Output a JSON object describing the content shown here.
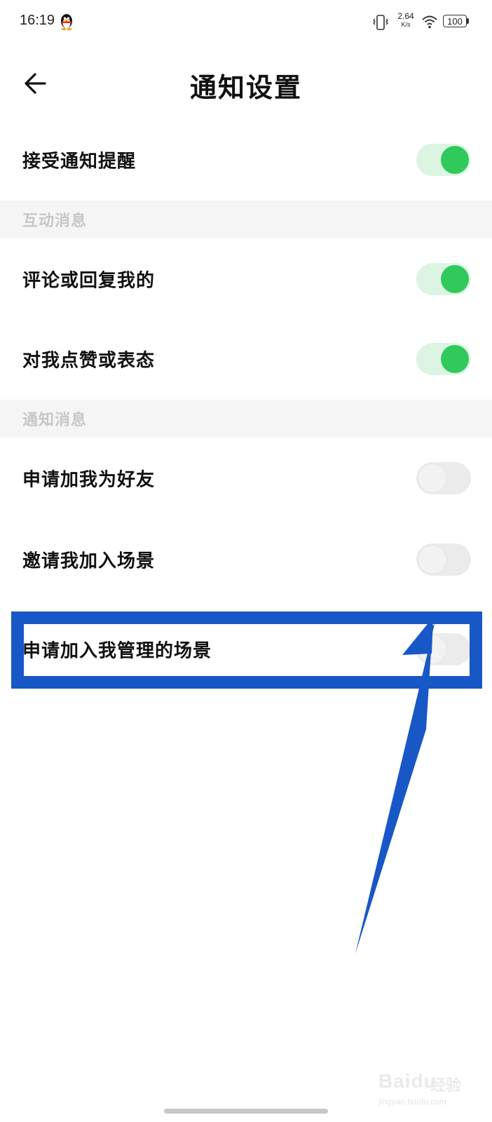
{
  "status_bar": {
    "time": "16:19",
    "net_speed_value": "2.64",
    "net_speed_unit": "K/s",
    "battery": "100"
  },
  "header": {
    "title": "通知设置"
  },
  "main_setting": {
    "label": "接受通知提醒",
    "enabled": true
  },
  "sections": [
    {
      "title": "互动消息",
      "items": [
        {
          "label": "评论或回复我的",
          "enabled": true
        },
        {
          "label": "对我点赞或表态",
          "enabled": true
        }
      ]
    },
    {
      "title": "通知消息",
      "items": [
        {
          "label": "申请加我为好友",
          "enabled": false
        },
        {
          "label": "邀请我加入场景",
          "enabled": false
        },
        {
          "label": "申请加入我管理的场景",
          "enabled": false
        }
      ]
    }
  ],
  "colors": {
    "toggle_on_track": "#dcf5e3",
    "toggle_on_knob": "#2fc95c",
    "toggle_off_track": "#ebebeb",
    "annotation_blue": "#1857c6",
    "section_bg": "#f5f5f5"
  },
  "watermark": {
    "brand": "Baidu",
    "product": "经验",
    "domain": "jingyan.baidu.com"
  }
}
